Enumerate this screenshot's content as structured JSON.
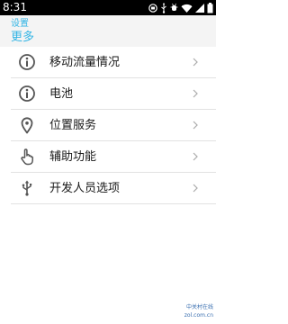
{
  "status_bar": {
    "time": "8:31",
    "icons": [
      "notification-icon",
      "usb-icon",
      "debug-icon",
      "wifi-icon",
      "signal-icon",
      "battery-icon"
    ]
  },
  "header": {
    "parent": "设置",
    "title": "更多",
    "accent_color": "#33b5e5"
  },
  "menu": {
    "items": [
      {
        "label": "移动流量情况",
        "icon": "info-icon"
      },
      {
        "label": "电池",
        "icon": "info-icon"
      },
      {
        "label": "位置服务",
        "icon": "location-icon"
      },
      {
        "label": "辅助功能",
        "icon": "hand-pointer-icon"
      },
      {
        "label": "开发人员选项",
        "icon": "usb-icon"
      }
    ]
  },
  "watermark": {
    "name": "中关村在线",
    "url": "zol.com.cn"
  }
}
